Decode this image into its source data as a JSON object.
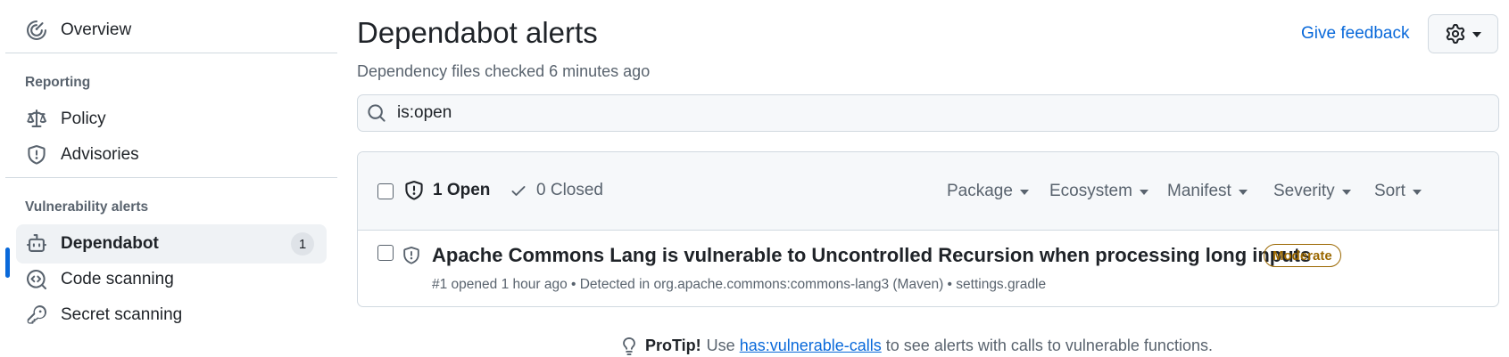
{
  "sidebar": {
    "overview_label": "Overview",
    "reporting_heading": "Reporting",
    "policy_label": "Policy",
    "advisories_label": "Advisories",
    "vuln_heading": "Vulnerability alerts",
    "dependabot_label": "Dependabot",
    "dependabot_count": "1",
    "code_scanning_label": "Code scanning",
    "secret_scanning_label": "Secret scanning"
  },
  "header": {
    "title": "Dependabot alerts",
    "subtitle": "Dependency files checked 6 minutes ago",
    "feedback_label": "Give feedback"
  },
  "search": {
    "value": "is:open"
  },
  "list": {
    "open_label": "1 Open",
    "closed_label": "0 Closed",
    "filters": {
      "package": "Package",
      "ecosystem": "Ecosystem",
      "manifest": "Manifest",
      "severity": "Severity",
      "sort": "Sort"
    },
    "alerts": [
      {
        "title": "Apache Commons Lang is vulnerable to Uncontrolled Recursion when processing long inputs",
        "severity": "Moderate",
        "meta": "#1 opened 1 hour ago • Detected in org.apache.commons:commons-lang3 (Maven) • settings.gradle"
      }
    ]
  },
  "protip": {
    "strong": "ProTip!",
    "before": "Use",
    "link": "has:vulnerable-calls",
    "after": "to see alerts with calls to vulnerable functions."
  },
  "colors": {
    "accent": "#0969da",
    "moderate": "#9a6700",
    "muted": "#59636e",
    "border": "#d1d9e0"
  }
}
